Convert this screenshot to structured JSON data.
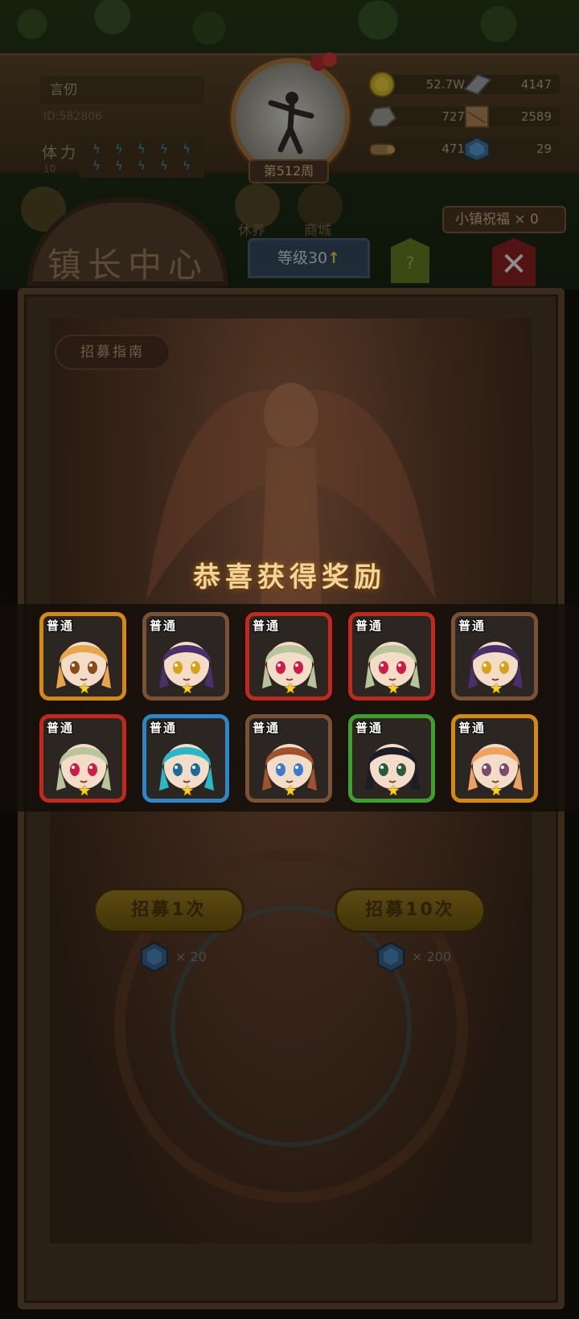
{
  "header": {
    "player_name": "言仞",
    "player_id": "ID:582806",
    "stamina_label": "体力",
    "stamina_value": "10",
    "stamina_bolts": [
      "ϟ",
      "ϟ",
      "ϟ",
      "ϟ",
      "ϟ",
      "ϟ",
      "ϟ",
      "ϟ",
      "ϟ",
      "ϟ"
    ],
    "week": "第512周",
    "resources": [
      {
        "icon": "gold-coin-icon",
        "value": "52.7W"
      },
      {
        "icon": "steel-bar-icon",
        "value": "4147"
      },
      {
        "icon": "stone-ore-icon",
        "value": "727"
      },
      {
        "icon": "cloth-icon",
        "value": "2589"
      },
      {
        "icon": "wood-log-icon",
        "value": "471"
      },
      {
        "icon": "blue-gem-icon",
        "value": "29"
      }
    ]
  },
  "nav": {
    "rest_label": "休养",
    "shop_label": "商城",
    "town_blessing": "小镇祝福 × 0"
  },
  "panel": {
    "title": "镇长中心",
    "level": "等级30",
    "level_up_icon": "arrow-up-icon",
    "help": "?",
    "close_icon": "close-icon",
    "guide_button": "招募指南",
    "recruit_once": "招募1次",
    "recruit_once_cost": "× 20",
    "recruit_ten": "招募10次",
    "recruit_ten_cost": "× 200"
  },
  "reward": {
    "title": "恭喜获得奖励",
    "cards": [
      {
        "tag": "普通",
        "frame": "gold",
        "hair": "#e8a64a",
        "eyes": "#8a4a1a",
        "stars": "★"
      },
      {
        "tag": "普通",
        "frame": "brown",
        "hair": "#4a2f6a",
        "eyes": "#d7a21a",
        "stars": "★"
      },
      {
        "tag": "普通",
        "frame": "red",
        "hair": "#b8c49a",
        "eyes": "#d01c44",
        "stars": "★"
      },
      {
        "tag": "普通",
        "frame": "red",
        "hair": "#b8c49a",
        "eyes": "#d01c44",
        "stars": "★"
      },
      {
        "tag": "普通",
        "frame": "brown",
        "hair": "#4a2f6a",
        "eyes": "#d7a21a",
        "stars": "★"
      },
      {
        "tag": "普通",
        "frame": "red",
        "hair": "#b8c49a",
        "eyes": "#d01c44",
        "stars": "★"
      },
      {
        "tag": "普通",
        "frame": "blue",
        "hair": "#2ab8c8",
        "eyes": "#1a6a9a",
        "stars": "★"
      },
      {
        "tag": "普通",
        "frame": "brown",
        "hair": "#a0522d",
        "eyes": "#3a7ad0",
        "stars": "★"
      },
      {
        "tag": "普通",
        "frame": "green",
        "hair": "#1d1d2a",
        "eyes": "#2a5a3a",
        "stars": "★"
      },
      {
        "tag": "普通",
        "frame": "gold",
        "hair": "#f0a060",
        "eyes": "#7a4a6a",
        "stars": "★"
      }
    ]
  },
  "colors": {
    "reward_title": "#f3d49a",
    "star": "#ffd21a",
    "frame_gold": "#c68a18",
    "frame_red": "#c0291d",
    "frame_blue": "#2d86c8",
    "frame_green": "#3fa12c",
    "frame_brown": "#7b5237"
  }
}
